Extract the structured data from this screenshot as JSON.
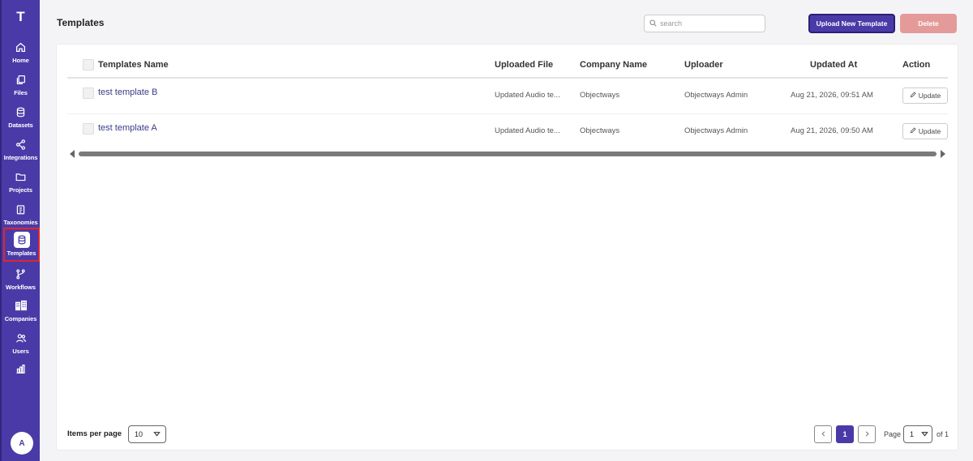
{
  "app": {
    "logo": "T"
  },
  "sidebar": {
    "items": [
      {
        "label": "Home",
        "icon": "home-icon"
      },
      {
        "label": "Files",
        "icon": "files-icon"
      },
      {
        "label": "Datasets",
        "icon": "database-icon"
      },
      {
        "label": "Integrations",
        "icon": "share-icon"
      },
      {
        "label": "Projects",
        "icon": "folder-icon"
      },
      {
        "label": "Taxonomies",
        "icon": "clipboard-icon"
      },
      {
        "label": "Templates",
        "icon": "template-icon",
        "active": true
      },
      {
        "label": "Workflows",
        "icon": "branch-icon"
      },
      {
        "label": "Companies",
        "icon": "building-icon"
      },
      {
        "label": "Users",
        "icon": "users-icon"
      },
      {
        "label": "",
        "icon": "chart-icon"
      }
    ],
    "avatar": "A"
  },
  "header": {
    "title": "Templates",
    "search_placeholder": "search",
    "upload_label": "Upload New Template",
    "delete_label": "Delete"
  },
  "table": {
    "columns": [
      "Templates Name",
      "Uploaded File",
      "Company Name",
      "Uploader",
      "Updated At",
      "Action"
    ],
    "rows": [
      {
        "name": "test template B",
        "file": "Updated Audio te...",
        "company": "Objectways",
        "uploader": "Objectways Admin",
        "updated": "Aug 21, 2026, 09:51 AM",
        "action": "Update"
      },
      {
        "name": "test template A",
        "file": "Updated Audio te...",
        "company": "Objectways",
        "uploader": "Objectways Admin",
        "updated": "Aug 21, 2026, 09:50 AM",
        "action": "Update"
      }
    ]
  },
  "footer": {
    "items_per_page_label": "Items per page",
    "items_per_page_value": "10",
    "current_page": "1",
    "page_label": "Page",
    "page_select_value": "1",
    "of_label": "of 1"
  },
  "colors": {
    "brand": "#4a3aa7",
    "delete": "#e59a9a",
    "active_outline": "#e0262e"
  }
}
